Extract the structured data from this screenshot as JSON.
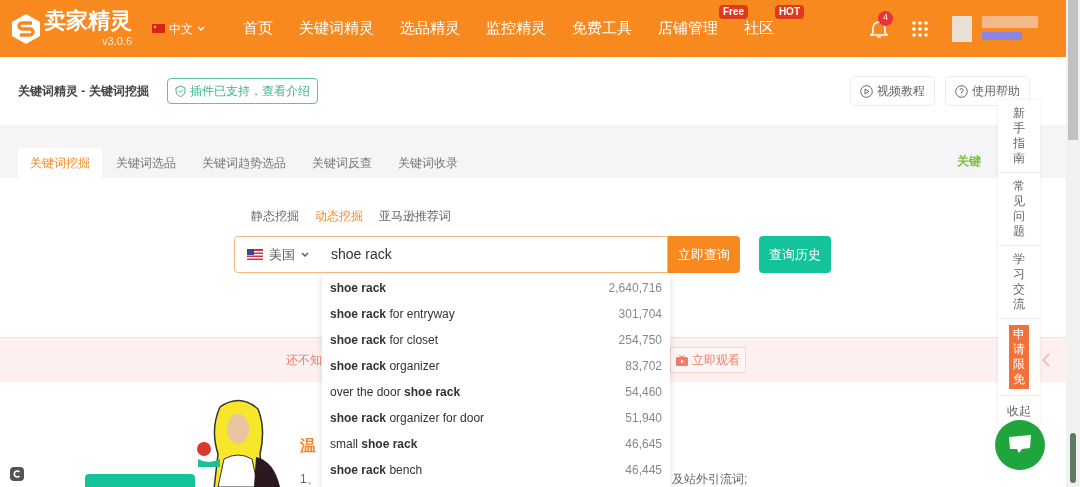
{
  "header": {
    "logo": "卖家精灵",
    "version": "v3.0.6",
    "language": {
      "label": "中文",
      "expanded": false
    },
    "nav": [
      {
        "label": "首页"
      },
      {
        "label": "关键词精灵"
      },
      {
        "label": "选品精灵"
      },
      {
        "label": "监控精灵"
      },
      {
        "label": "免费工具"
      },
      {
        "label": "店铺管理",
        "badge": "Free"
      },
      {
        "label": "社区",
        "badge": "HOT"
      }
    ],
    "notification_count": "4"
  },
  "breadcrumb": "关键词精灵 - 关键词挖掘",
  "plugin_notice": "插件已支持，查看介绍",
  "help_buttons": [
    {
      "kind": "video",
      "label": "视频教程"
    },
    {
      "kind": "help",
      "label": "使用帮助"
    }
  ],
  "tabs": [
    {
      "label": "关键词挖掘",
      "selected": true
    },
    {
      "label": "关键词选品",
      "selected": false
    },
    {
      "label": "关键词趋势选品",
      "selected": false
    },
    {
      "label": "关键词反查",
      "selected": false
    },
    {
      "label": "关键词收录",
      "selected": false
    }
  ],
  "tabs_right_text": "关键",
  "mode_tabs": [
    {
      "label": "静态挖掘",
      "selected": false
    },
    {
      "label": "动态挖掘",
      "selected": true
    },
    {
      "label": "亚马逊推荐词",
      "selected": false
    }
  ],
  "search": {
    "country": "美国",
    "value": "shoe rack",
    "submit": "立即查询",
    "history": "查询历史"
  },
  "suggestions": [
    {
      "text": "**shoe rack**",
      "count": "2,640,716"
    },
    {
      "text": "**shoe rack** for entryway",
      "count": "301,704"
    },
    {
      "text": "**shoe rack** for closet",
      "count": "254,750"
    },
    {
      "text": "**shoe rack** organizer",
      "count": "83,702"
    },
    {
      "text": "over the door **shoe rack**",
      "count": "54,460"
    },
    {
      "text": "**shoe rack** organizer for door",
      "count": "51,940"
    },
    {
      "text": "small **shoe rack**",
      "count": "46,645"
    },
    {
      "text": "**shoe rack** bench",
      "count": "46,445"
    }
  ],
  "banner": {
    "text": "还不知",
    "action": "立即观看"
  },
  "tips": {
    "title": "温",
    "line_start": "1、",
    "line_end": "及站外引流词;"
  },
  "side_panel": [
    {
      "label": "新手指南",
      "highlighted": false
    },
    {
      "label": "常见问题",
      "highlighted": false
    },
    {
      "label": "学习交流",
      "highlighted": false
    },
    {
      "label": "申请限免",
      "highlighted": true
    },
    {
      "label": "收起",
      "highlighted": false
    }
  ]
}
